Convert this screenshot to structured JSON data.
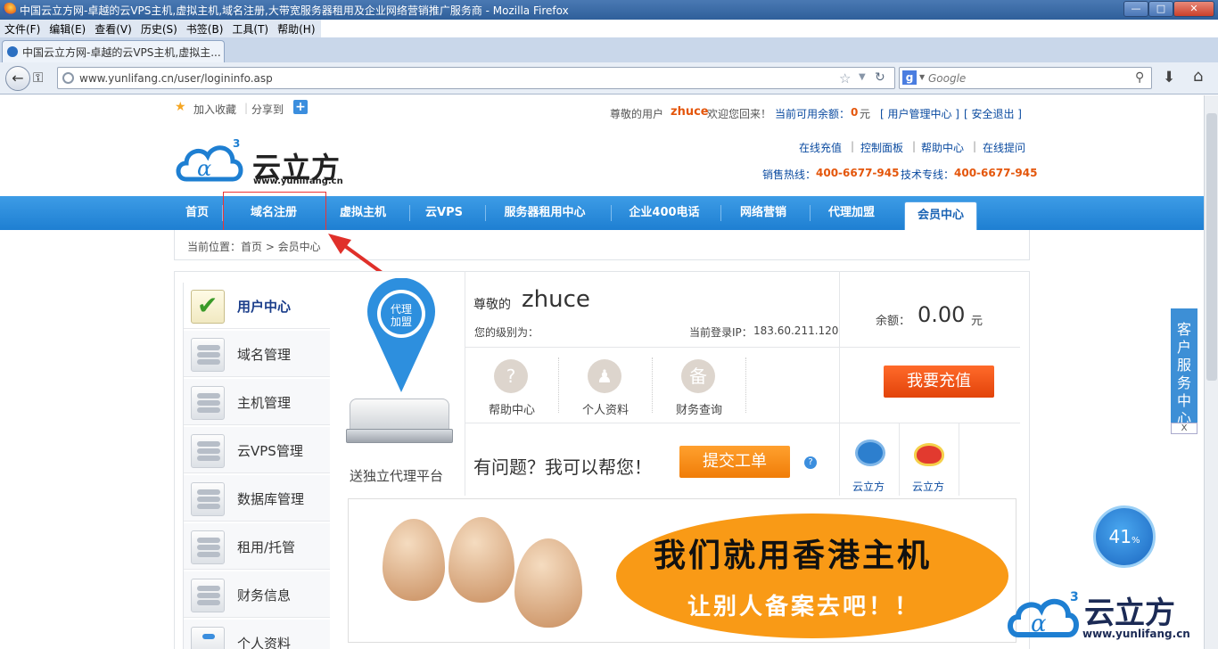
{
  "window": {
    "title": "中国云立方网-卓越的云VPS主机,虚拟主机,域名注册,大带宽服务器租用及企业网络营销推广服务商 - Mozilla Firefox",
    "minimize": "—",
    "maximize": "□",
    "close": "✕"
  },
  "menu": [
    "文件(F)",
    "编辑(E)",
    "查看(V)",
    "历史(S)",
    "书签(B)",
    "工具(T)",
    "帮助(H)"
  ],
  "tab": {
    "label": "中国云立方网-卓越的云VPS主机,虚拟主..."
  },
  "addressbar": {
    "url": "www.yunlifang.cn/user/logininfo.asp"
  },
  "search": {
    "placeholder": "Google"
  },
  "topbar": {
    "favorite": "加入收藏",
    "share": "分享到",
    "greeting_prefix": "尊敬的用户",
    "username": "zhuce",
    "greeting_suffix": "欢迎您回来！",
    "balance_label": "当前可用余额：",
    "balance_value": "0",
    "balance_unit": "元",
    "user_center_link": "[ 用户管理中心 ]",
    "logout_link": "[ 安全退出 ]"
  },
  "header": {
    "logo_text": "云立方",
    "logo_url": "www.yunlifang.cn",
    "links": [
      "在线充值",
      "控制面板",
      "帮助中心",
      "在线提问"
    ],
    "hotline_label": "销售热线：",
    "hotline": "400-6677-945",
    "tech_label": "技术专线：",
    "tech": "400-6677-945"
  },
  "nav": [
    "首页",
    "域名注册",
    "虚拟主机",
    "云VPS",
    "服务器租用中心",
    "企业400电话",
    "网络营销",
    "代理加盟"
  ],
  "nav_active": "会员中心",
  "breadcrumb": "当前位置：首页 > 会员中心",
  "sidebar": [
    {
      "label": "用户中心",
      "active": true
    },
    {
      "label": "域名管理"
    },
    {
      "label": "主机管理"
    },
    {
      "label": "云VPS管理"
    },
    {
      "label": "数据库管理"
    },
    {
      "label": "租用/托管"
    },
    {
      "label": "财务信息"
    },
    {
      "label": "个人资料"
    }
  ],
  "promo": {
    "pin_line1": "代理",
    "pin_line2": "加盟",
    "caption": "送独立代理平台"
  },
  "user": {
    "salutation": "尊敬的",
    "name": "zhuce",
    "level_label": "您的级别为：",
    "ip_label": "当前登录IP：",
    "ip": "183.60.211.120"
  },
  "balance": {
    "label": "余额：",
    "value": "0.00",
    "unit": "元",
    "recharge_button": "我要充值"
  },
  "services": [
    {
      "icon": "?",
      "label": "帮助中心"
    },
    {
      "icon": "♟",
      "label": "个人资料"
    },
    {
      "icon": "备",
      "label": "财务查询"
    }
  ],
  "help": {
    "text": "有问题？我可以帮您！",
    "ticket_button": "提交工单",
    "info_icon": "?"
  },
  "social": [
    {
      "label": "云立方"
    },
    {
      "label": "云立方"
    }
  ],
  "banner": {
    "line1": "我们就用香港主机",
    "line2": "让别人备案去吧！！"
  },
  "kefu": {
    "text": "客户服务中心",
    "close": "X"
  },
  "speed": {
    "value": "41",
    "unit": "%"
  },
  "watermark": {
    "text": "云立方",
    "url": "www.yunlifang.cn"
  },
  "colors": {
    "nav_blue": "#1e7fd2",
    "accent_orange": "#e4560b",
    "link_blue": "#0b4ba0"
  }
}
